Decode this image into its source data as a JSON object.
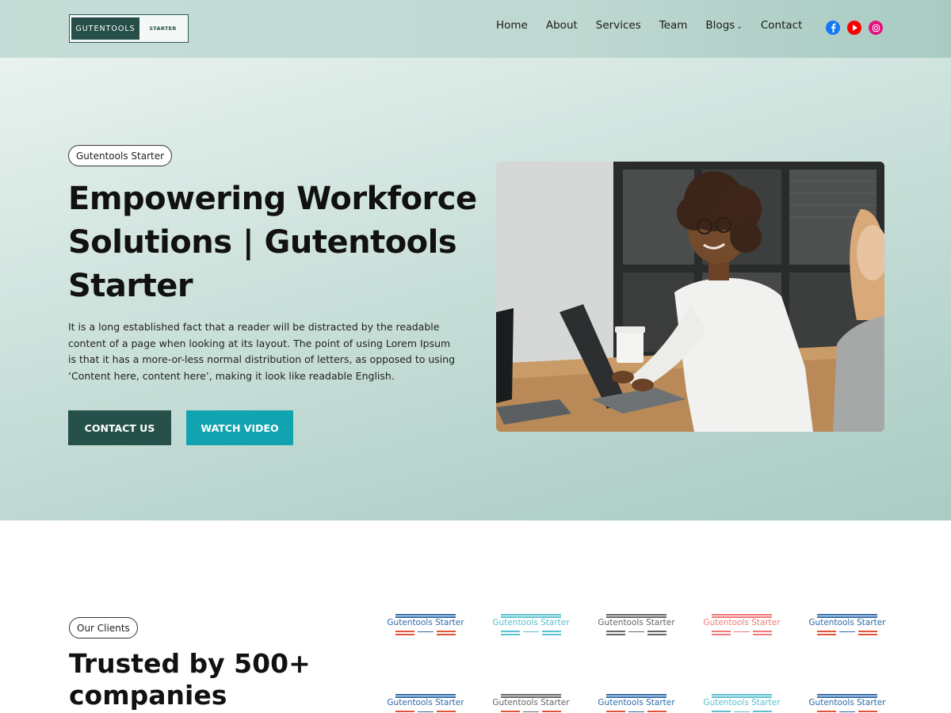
{
  "header": {
    "logo_main": "GUTENTOOLS",
    "logo_sub": "STARTER",
    "nav": [
      {
        "label": "Home"
      },
      {
        "label": "About"
      },
      {
        "label": "Services"
      },
      {
        "label": "Team"
      },
      {
        "label": "Blogs",
        "dropdown": true
      },
      {
        "label": "Contact"
      }
    ],
    "social": [
      {
        "icon": "facebook-icon",
        "color": "#1877f2"
      },
      {
        "icon": "youtube-icon",
        "color": "#ff0000"
      },
      {
        "icon": "instagram-icon",
        "color": "#e3147f"
      }
    ],
    "dropdown_chevron": "⌄"
  },
  "hero": {
    "badge": "Gutentools Starter",
    "title": "Empowering Workforce Solutions | Gutentools Starter",
    "text": "It is a long established fact that a reader will be distracted by the readable content of a page when looking at its layout. The point of using Lorem Ipsum is that it has a more-or-less normal distribution of letters, as opposed to using ‘Content here, content here’, making it look like readable English.",
    "buttons": {
      "contact": "CONTACT US",
      "video": "WATCH VIDEO"
    },
    "image": "woman-working-on-laptop-photo"
  },
  "clients": {
    "badge": "Our Clients",
    "title": "Trusted by 500+ companies",
    "logos": [
      {
        "text": "Gutentools Starter",
        "color": "#2f6aa8",
        "accent": "#e0553a"
      },
      {
        "text": "Gutentools Starter",
        "color": "#5bc0cf",
        "accent": "#5bc0cf"
      },
      {
        "text": "Gutentools Starter",
        "color": "#666666",
        "accent": "#666666"
      },
      {
        "text": "Gutentools Starter",
        "color": "#f07a7a",
        "accent": "#f07a7a"
      },
      {
        "text": "Gutentools Starter",
        "color": "#2f6aa8",
        "accent": "#e0553a"
      },
      {
        "text": "Gutentools Starter",
        "color": "#2f6aa8",
        "accent": "#e0553a"
      },
      {
        "text": "Gutentools Starter",
        "color": "#666666",
        "accent": "#e0553a"
      },
      {
        "text": "Gutentools Starter",
        "color": "#2f6aa8",
        "accent": "#e0553a"
      },
      {
        "text": "Gutentools Starter",
        "color": "#5bc0cf",
        "accent": "#5bc0cf"
      },
      {
        "text": "Gutentools Starter",
        "color": "#2f6aa8",
        "accent": "#e0553a"
      }
    ]
  },
  "colors": {
    "brand_dark": "#25514a",
    "brand_teal": "#12a3b0",
    "hero_bg": "#bcd7d0"
  }
}
